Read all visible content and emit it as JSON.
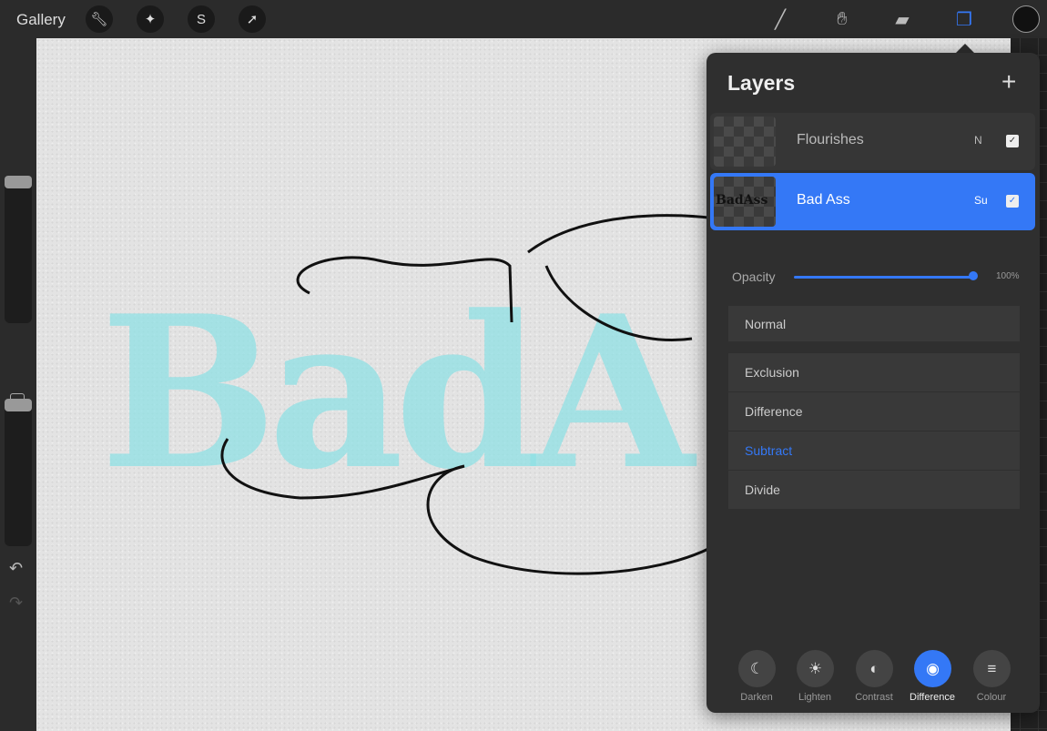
{
  "topbar": {
    "gallery": "Gallery",
    "tools_left": [
      "wrench-icon",
      "magic-wand-icon",
      "selection-icon",
      "transform-arrow-icon"
    ],
    "tools_right": [
      "brush-icon",
      "smudge-icon",
      "eraser-icon",
      "layers-icon"
    ],
    "color_swatch": "#111111"
  },
  "sidebar": {
    "undo": "↶",
    "redo": "↷"
  },
  "canvas": {
    "artwork_text": "BadA",
    "ink_color": "#8fe0e4"
  },
  "layers": {
    "title": "Layers",
    "add": "+",
    "items": [
      {
        "name": "Flourishes",
        "mode": "N",
        "visible": true,
        "selected": false
      },
      {
        "name": "Bad Ass",
        "mode": "Su",
        "visible": true,
        "selected": true
      }
    ],
    "opacity_label": "Opacity",
    "opacity_value": "100%",
    "opacity": 1.0,
    "current_mode": "Normal",
    "modes": [
      "Exclusion",
      "Difference",
      "Subtract",
      "Divide"
    ],
    "selected_mode": "Subtract",
    "categories": [
      {
        "label": "Darken",
        "icon": "☾"
      },
      {
        "label": "Lighten",
        "icon": "☀"
      },
      {
        "label": "Contrast",
        "icon": "◐"
      },
      {
        "label": "Difference",
        "icon": "◉"
      },
      {
        "label": "Colour",
        "icon": "≡"
      }
    ],
    "selected_category": "Difference",
    "accent": "#3478f6"
  }
}
